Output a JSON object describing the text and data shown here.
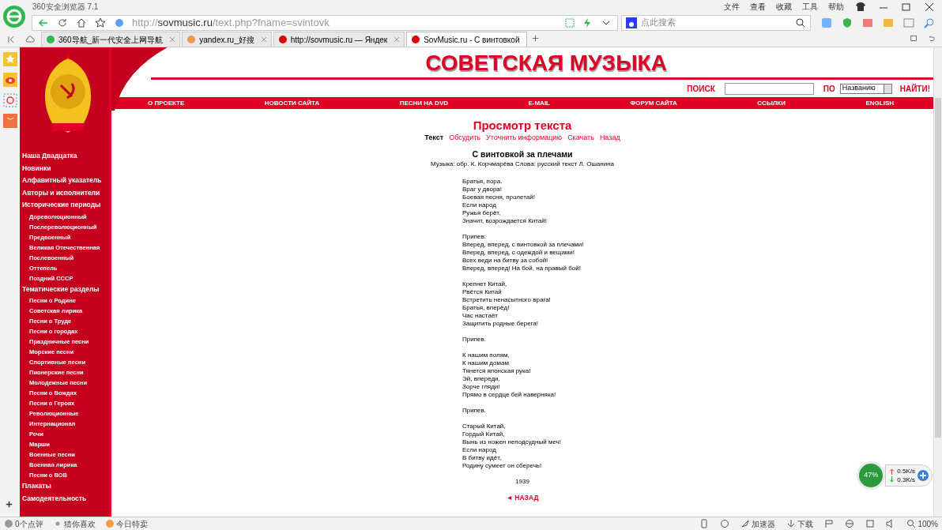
{
  "browser": {
    "title": "360安全浏览器 7.1",
    "menu": [
      "文件",
      "查看",
      "收藏",
      "工具",
      "帮助"
    ],
    "address": {
      "scheme": "http://",
      "domain": "sovmusic.ru",
      "path": "/text.php?fname=svintovk"
    },
    "search": {
      "placeholder": "点此搜索"
    },
    "tabs": [
      {
        "label": "360导航_新一代安全上网导航",
        "selected": false
      },
      {
        "label": "yandex.ru_好搜",
        "selected": false
      },
      {
        "label": "http://sovmusic.ru — Яндек",
        "selected": false
      },
      {
        "label": "SovMusic.ru - С винтовкой",
        "selected": true
      }
    ]
  },
  "site": {
    "title": "СОВЕТСКАЯ МУЗЫКА",
    "search": {
      "label": "ПОИСК",
      "by_label": "ПО",
      "by_value": "Названию",
      "submit": "НАЙТИ!"
    },
    "nav": [
      "О ПРОЕКТЕ",
      "НОВОСТИ САЙТА",
      "ПЕСНИ НА DVD",
      "E-MAIL",
      "ФОРУМ САЙТА",
      "ССЫЛКИ",
      "ENGLISH"
    ],
    "sidebar": [
      {
        "label": "Наша Двадцатка"
      },
      {
        "label": "Новинки"
      },
      {
        "label": "Алфавитный указатель"
      },
      {
        "label": "Авторы и исполнители"
      },
      {
        "label": "Исторические периоды",
        "children": [
          {
            "label": "Дореволюционный"
          },
          {
            "label": "Послереволюционный"
          },
          {
            "label": "Предвоенный"
          },
          {
            "label": "Великая Отечественная"
          },
          {
            "label": "Послевоенный"
          },
          {
            "label": "Оттепель"
          },
          {
            "label": "Поздний СССР"
          }
        ]
      },
      {
        "label": "Тематические разделы",
        "children": [
          {
            "label": "Песни о Родине"
          },
          {
            "label": "Советская лирика"
          },
          {
            "label": "Песни о Труде"
          },
          {
            "label": "Песни о городах"
          },
          {
            "label": "Праздничные песни"
          },
          {
            "label": "Морские песни"
          },
          {
            "label": "Спортивные песни"
          },
          {
            "label": "Пионерские песни"
          },
          {
            "label": "Молодежные песни"
          },
          {
            "label": "Песни о Вождях"
          },
          {
            "label": "Песни о Героях"
          },
          {
            "label": "Революционные"
          },
          {
            "label": "Интернационал"
          },
          {
            "label": "Речи"
          },
          {
            "label": "Марши"
          },
          {
            "label": "Военные песни"
          },
          {
            "label": "Военная лирика"
          },
          {
            "label": "Песни о ВОВ"
          }
        ]
      },
      {
        "label": "Плакаты"
      },
      {
        "label": "Самодеятельность"
      }
    ],
    "page_heading": "Просмотр текста",
    "links": [
      {
        "label": "Текст",
        "selected": true
      },
      {
        "label": "Обсудить",
        "selected": false
      },
      {
        "label": "Уточнить информацию",
        "selected": false
      },
      {
        "label": "Скачать",
        "selected": false
      },
      {
        "label": "Назад",
        "selected": false
      }
    ],
    "song_title": "С винтовкой за плечами",
    "credits": "Музыка: обр. К. Корчмарёва Слова: русский текст Л. Ошанина",
    "stanzas": [
      [
        "Братья, пора.",
        "Враг у двора!",
        "Боевая песня, пролетай!",
        "Если народ",
        "Ружья берёт,",
        "Значит, возрождается Китай!"
      ],
      [
        "Припев:",
        "Вперед, вперед, с винтовкой за плечами!",
        "Вперед, вперед, с одеждой и вещами!",
        "Всех веди на битву за собой!",
        "Вперед, вперед! На бой, на правый бой!"
      ],
      [
        "Крепнет Китай,",
        "Рвётся Китай",
        "Встретить ненасытного врага!",
        "Братья, вперёд!",
        "Час настаёт",
        "Защитить родные берега!"
      ],
      [
        "Припев."
      ],
      [
        "К нашим полям,",
        "К нашим домам",
        "Тянется японская рука!",
        "Эй, впереди,",
        "Зорче гляди!",
        "Прямо в сердце бей наверняка!"
      ],
      [
        "Припев."
      ],
      [
        "Старый Китай,",
        "Гордый Китай,",
        "Вынь из ножен неподсудный меч!",
        "Если народ",
        "В битву идёт,",
        "Родину сумеет он сберечь!"
      ]
    ],
    "year": "1939",
    "back": "◄ НАЗАД"
  },
  "net_widget": {
    "percent": "47%",
    "upload": "0.5K/s",
    "download": "0.3K/s"
  },
  "status_bar": {
    "left": [
      "0个点评",
      "猜你喜欢",
      "今日特卖"
    ],
    "accelerator": "加速器",
    "download": "下载",
    "zoom": "100%"
  }
}
